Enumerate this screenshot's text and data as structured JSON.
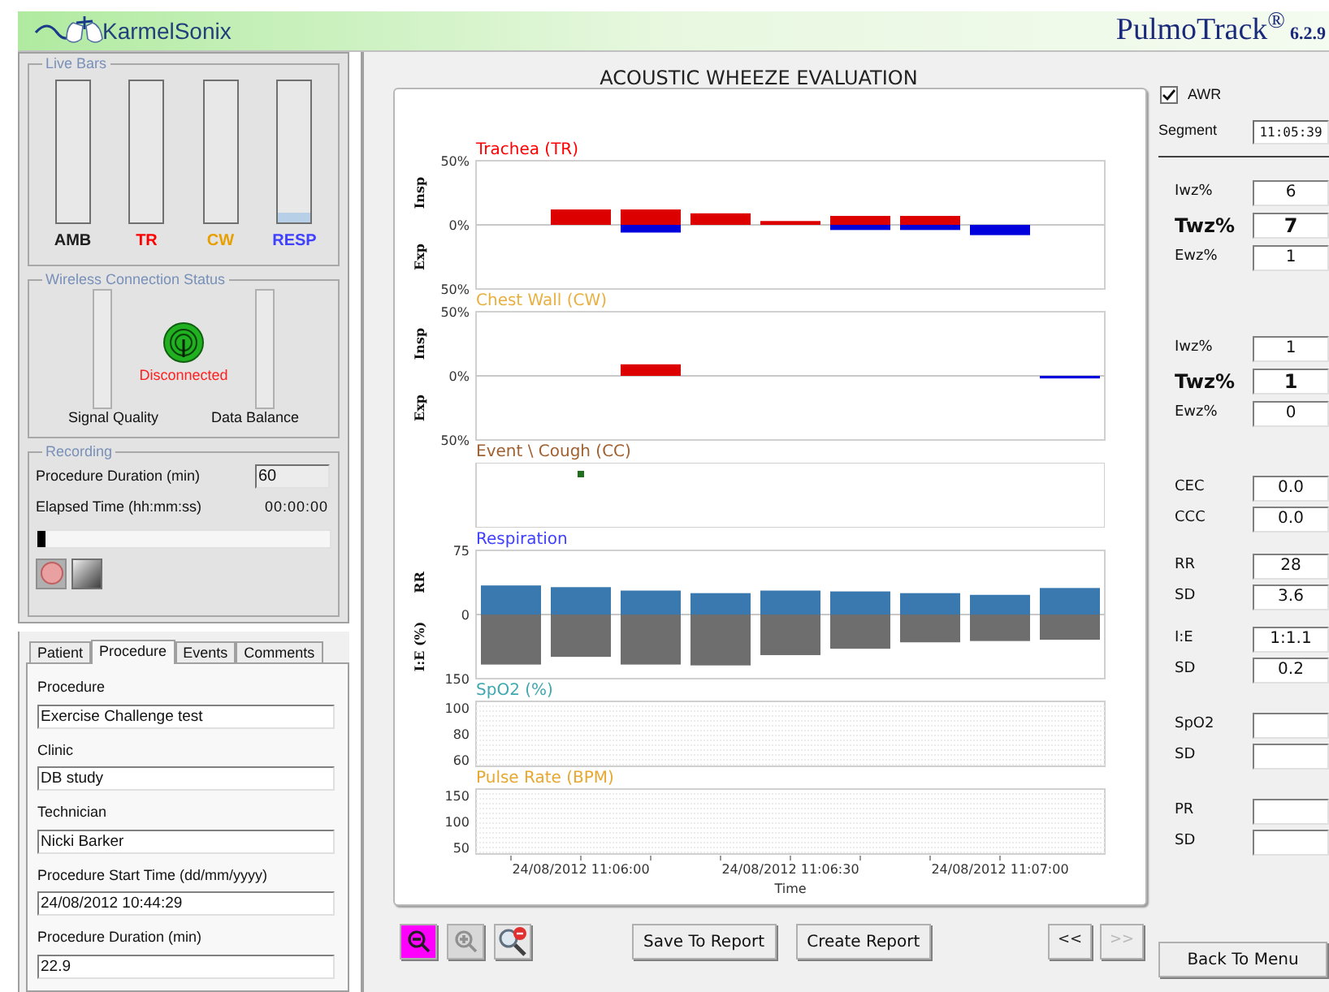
{
  "header": {
    "logo_text": "KarmelSonix",
    "product": "PulmoTrack$^{®}$",
    "version": "6.2.9"
  },
  "live_bars": {
    "legend": "Live Bars",
    "bars": [
      {
        "label": "AMB",
        "color": "#202020",
        "level": 0
      },
      {
        "label": "TR",
        "color": "#ff0000",
        "level": 0
      },
      {
        "label": "CW",
        "color": "#e8a000",
        "level": 0
      },
      {
        "label": "RESP",
        "color": "#4040ff",
        "level": 0.07
      }
    ]
  },
  "wireless": {
    "legend": "Wireless Connection Status",
    "status": "Disconnected",
    "connected": false,
    "left_label": "Signal Quality",
    "right_label": "Data Balance"
  },
  "recording": {
    "legend": "Recording",
    "duration_label": "Procedure Duration (min)",
    "duration_value": "60",
    "elapsed_label": "Elapsed Time (hh:mm:ss)",
    "elapsed_value": "00:00:00",
    "level": 0.03,
    "buttons": [
      {
        "kind": "record"
      },
      {
        "kind": "stop"
      }
    ]
  },
  "tabs": [
    {
      "label": "Patient",
      "selected": false
    },
    {
      "label": "Procedure",
      "selected": true
    },
    {
      "label": "Events",
      "selected": false
    },
    {
      "label": "Comments",
      "selected": false
    }
  ],
  "procedure_fields": [
    {
      "label": "Procedure",
      "value": "Exercise Challenge test"
    },
    {
      "label": "Clinic",
      "value": "DB study"
    },
    {
      "label": "Technician",
      "value": "Nicki Barker"
    },
    {
      "label": "Procedure Start Time (dd/mm/yyyy)",
      "value": "24/08/2012 10:44:29"
    },
    {
      "label": "Procedure Duration (min)",
      "value": "22.9"
    }
  ],
  "main": {
    "title": "ACOUSTIC WHEEZE EVALUATION"
  },
  "charts": [
    {
      "kind": "bars",
      "color": "#ff0000",
      "axis_labels": [
        "Insp",
        "Exp"
      ],
      "chart_data": {
        "type": "bar",
        "title": "Trachea (TR)",
        "ylim": [
          -50,
          50
        ],
        "yticks": [
          {
            "value": 50,
            "label": "50%"
          },
          {
            "value": 0,
            "label": "0%"
          },
          {
            "value": -50,
            "label": "50%"
          }
        ],
        "series": [
          {
            "color": "#dd0000",
            "values": [
              null,
              12,
              12,
              9,
              3,
              7,
              7,
              null,
              null
            ]
          },
          {
            "color": "#0000dd",
            "values": [
              null,
              null,
              -6,
              null,
              null,
              -4,
              -4,
              -8,
              null
            ]
          }
        ]
      }
    },
    {
      "kind": "bars",
      "color": "#e8b040",
      "axis_labels": [
        "Insp",
        "Exp"
      ],
      "chart_data": {
        "type": "bar",
        "title": "Chest Wall (CW)",
        "ylim": [
          -50,
          50
        ],
        "yticks": [
          {
            "value": 50,
            "label": "50%"
          },
          {
            "value": 0,
            "label": "0%"
          },
          {
            "value": -50,
            "label": "50%"
          }
        ],
        "series": [
          {
            "color": "#dd0000",
            "values": [
              null,
              null,
              9,
              null,
              null,
              null,
              null,
              null,
              null
            ]
          },
          {
            "color": "#0000dd",
            "values": [
              null,
              null,
              null,
              null,
              null,
              null,
              null,
              null,
              -2
            ]
          }
        ]
      }
    },
    {
      "kind": "events",
      "color": "#a06030",
      "title": "Event \\ Cough (CC)"
    },
    {
      "kind": "respiration",
      "color": "#4040ff",
      "title": "Respiration",
      "axis_labels": [
        "RR",
        "I:E (%)"
      ],
      "y_labels": [
        "75",
        "0",
        "150"
      ]
    },
    {
      "kind": "grid",
      "color": "#40a8b0",
      "title": "SpO2 (%)",
      "y_labels": [
        "100",
        "80",
        "60"
      ]
    },
    {
      "kind": "grid",
      "color": "#e8a830",
      "title": "Pulse Rate (BPM)",
      "y_labels": [
        "150",
        "100",
        "50"
      ],
      "x_labels": [
        "24/08/2012 11:06:00",
        "24/08/2012 11:06:30",
        "24/08/2012 11:07:00"
      ],
      "x_title": "Time"
    }
  ],
  "toolbar": [
    {
      "kind": "zoom-out",
      "selected": true,
      "disabled": false
    },
    {
      "kind": "zoom-in",
      "selected": false,
      "disabled": true
    },
    {
      "kind": "zoom-reset",
      "selected": false,
      "disabled": false
    }
  ],
  "actions": [
    "Save To Report",
    "Create Report"
  ],
  "nav": [
    {
      "label": "<<",
      "disabled": false
    },
    {
      "label": ">>",
      "disabled": true
    }
  ],
  "side": {
    "awr_label": "AWR",
    "awr_checked": true,
    "segment_label": "Segment",
    "segment_value": "11:05:39",
    "back_button": "Back To Menu"
  },
  "stat_groups": [
    {
      "items": [
        {
          "label": "Iwz%",
          "value": "6",
          "bold": false
        },
        {
          "label": "Twz%",
          "value": "7",
          "bold": true
        },
        {
          "label": "Ewz%",
          "value": "1",
          "bold": false
        }
      ]
    },
    {
      "items": [
        {
          "label": "Iwz%",
          "value": "1",
          "bold": false
        },
        {
          "label": "Twz%",
          "value": "1",
          "bold": true
        },
        {
          "label": "Ewz%",
          "value": "0",
          "bold": false
        }
      ]
    },
    {
      "items": [
        {
          "label": "CEC",
          "value": "0.0",
          "bold": false
        },
        {
          "label": "CCC",
          "value": "0.0",
          "bold": false
        }
      ]
    },
    {
      "items": [
        {
          "label": "RR",
          "value": "28",
          "bold": false
        },
        {
          "label": "SD",
          "value": "3.6",
          "bold": false
        }
      ]
    },
    {
      "items": [
        {
          "label": "I:E",
          "value": "1:1.1",
          "bold": false
        },
        {
          "label": "SD",
          "value": "0.2",
          "bold": false
        }
      ]
    },
    {
      "items": [
        {
          "label": "SpO2",
          "bold": false
        },
        {
          "label": "SD",
          "bold": false
        }
      ]
    },
    {
      "items": [
        {
          "label": "PR",
          "bold": false
        },
        {
          "label": "SD",
          "bold": false
        }
      ]
    }
  ]
}
